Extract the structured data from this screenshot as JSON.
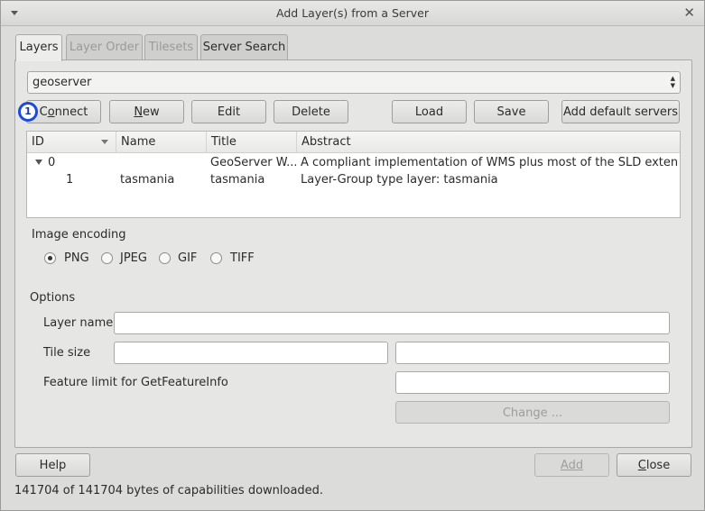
{
  "window": {
    "title": "Add Layer(s) from a Server"
  },
  "tabs": [
    "Layers",
    "Layer Order",
    "Tilesets",
    "Server Search"
  ],
  "connection": {
    "selected": "geoserver",
    "buttons": {
      "connect": {
        "pre": "C",
        "u": "o",
        "post": "nnect"
      },
      "new": {
        "pre": "",
        "u": "N",
        "post": "ew"
      },
      "edit": "Edit",
      "delete": "Delete",
      "load": "Load",
      "save": "Save",
      "add_default": "Add default servers"
    },
    "badge": "1"
  },
  "layers_table": {
    "columns": [
      "ID",
      "Name",
      "Title",
      "Abstract"
    ],
    "rows": [
      {
        "id": "0",
        "name": "",
        "title": "GeoServer W...",
        "abstract": "A compliant implementation of WMS plus most of the SLD extensio..."
      },
      {
        "id": "1",
        "name": "tasmania",
        "title": "tasmania",
        "abstract": "Layer-Group type layer: tasmania"
      }
    ]
  },
  "image_encoding": {
    "label": "Image encoding",
    "options": [
      "PNG",
      "JPEG",
      "GIF",
      "TIFF"
    ],
    "selected": "PNG"
  },
  "options": {
    "label": "Options",
    "layer_name_label": "Layer name",
    "tile_size_label": "Tile size",
    "feature_limit_label": "Feature limit for GetFeatureInfo",
    "change_button": "Change ..."
  },
  "footer": {
    "help": "Help",
    "add": "Add",
    "close": {
      "pre": "",
      "u": "C",
      "post": "lose"
    },
    "status": "141704 of 141704 bytes of capabilities downloaded."
  }
}
